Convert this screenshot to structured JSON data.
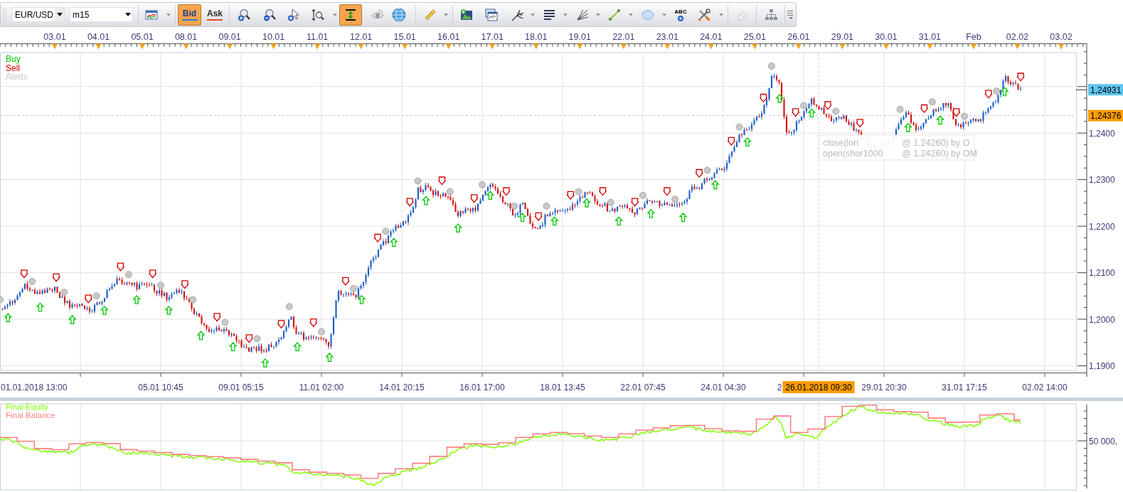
{
  "toolbar": {
    "symbol": "EUR/USD",
    "timeframe": "m15",
    "quote_tabs": [
      {
        "label": "Bid",
        "selected": true
      },
      {
        "label": "Ask",
        "selected": false
      }
    ],
    "scale_toggle": {
      "on": true
    },
    "text_tool_label": "ABC",
    "erase_tool": {
      "disabled": true
    }
  },
  "date_ruler": [
    "03.01",
    "04.01",
    "05.01",
    "08.01",
    "09.01",
    "10.01",
    "11.01",
    "12.01",
    "15.01",
    "16.01",
    "17.01",
    "18.01",
    "19.01",
    "22.01",
    "23.01",
    "24.01",
    "25.01",
    "26.01",
    "29.01",
    "30.01",
    "31.01",
    "Feb",
    "02.02",
    "03.02"
  ],
  "price_chart": {
    "legend": [
      {
        "kind": "buy",
        "label": "Buy",
        "color": "#00c800"
      },
      {
        "kind": "sell",
        "label": "Sell",
        "color": "#d20000"
      },
      {
        "kind": "alert",
        "label": "Alerts",
        "color": "#c8c8c8"
      }
    ],
    "tooltip": {
      "lines": [
        [
          "close(lon",
          "@ 1.24260) by O"
        ],
        [
          "open(shor",
          "1000",
          "@ 1.24260) by OM"
        ]
      ]
    },
    "price_labels": [
      "1,2400",
      "1,2300",
      "1,2200",
      "1,2100",
      "1,2000",
      "1,1900"
    ],
    "last_price": "1,24931",
    "time_labels": [
      "01.01.2018 13:00",
      "05.01 10:45",
      "09.01 05:15",
      "11.01 02:00",
      "14.01 20:15",
      "16.01 17:00",
      "18.01 13:45",
      "22.01 07:45",
      "24.01 04:30",
      "2",
      "29.01 20:30",
      "31.01 17:15",
      "02.02 14:00"
    ],
    "crosshair": {
      "price": "1,24376",
      "time": "26.01.2018 09:30"
    }
  },
  "equity_panel": {
    "legend": [
      {
        "label": "Final Equity",
        "color": "#80ff00"
      },
      {
        "label": "Final Balance",
        "color": "#ff8080"
      }
    ],
    "axis_label": "50 000,"
  }
}
